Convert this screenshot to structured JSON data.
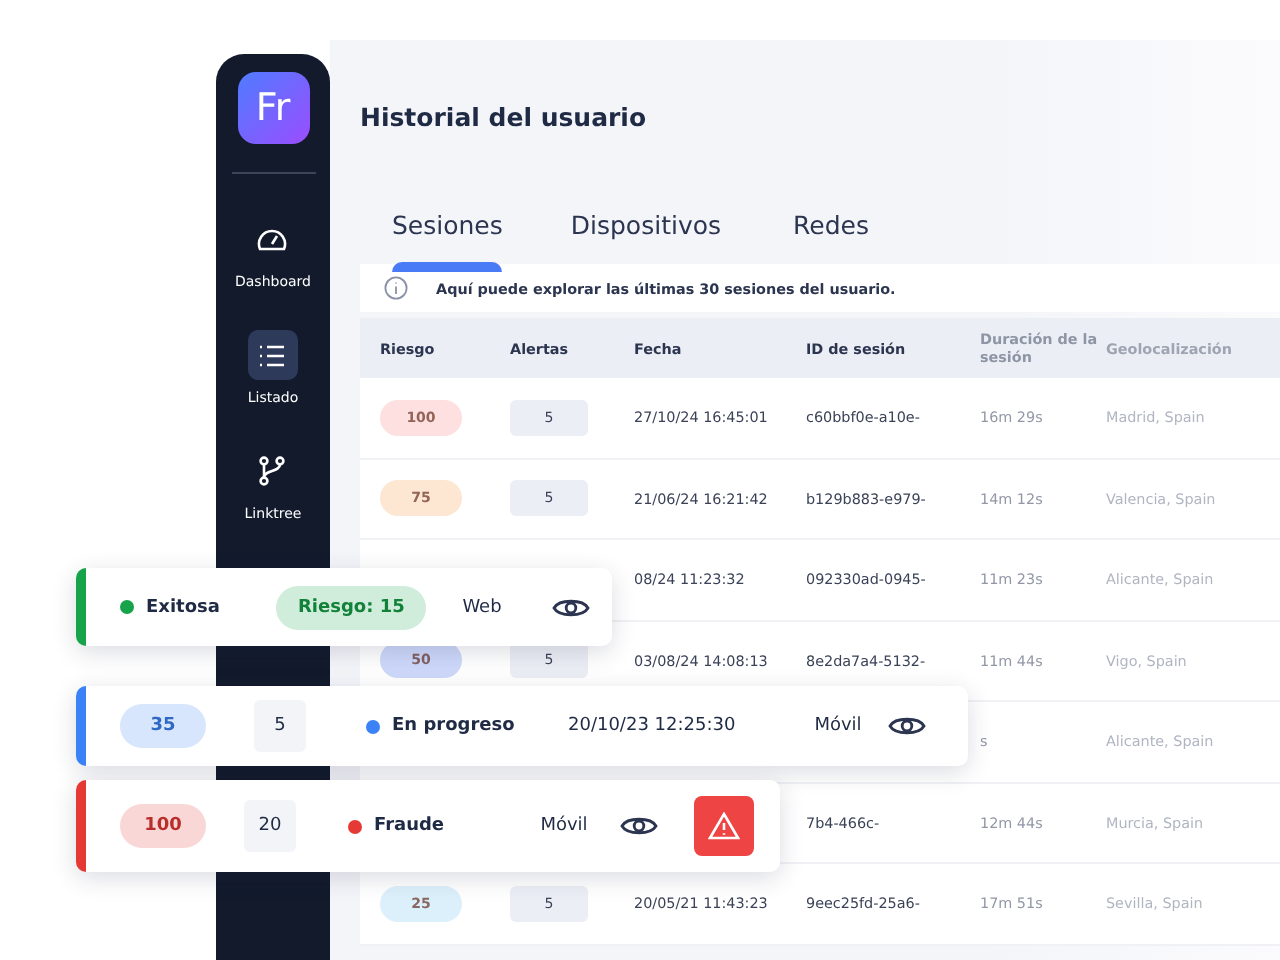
{
  "sidebar": {
    "logo": "Fr",
    "items": [
      {
        "label": "Dashboard",
        "selected": false
      },
      {
        "label": "Listado",
        "selected": true
      },
      {
        "label": "Linktree",
        "selected": false
      }
    ]
  },
  "title": "Historial del usuario",
  "tabs": [
    {
      "label": "Sesiones",
      "selected": true
    },
    {
      "label": "Dispositivos",
      "selected": false
    },
    {
      "label": "Redes",
      "selected": false
    }
  ],
  "info": "Aquí puede explorar las últimas 30 sesiones del usuario.",
  "table": {
    "columns": [
      "Riesgo",
      "Alertas",
      "Fecha",
      "ID de sesión",
      "Duración de la sesión",
      "Geolocalización"
    ],
    "rows": [
      {
        "risk": "100",
        "color": "#fde0df",
        "alerts": "5",
        "date": "27/10/24 16:45:01",
        "id": "c60bbf0e-a10e-",
        "duration": "16m 29s",
        "geo": "Madrid, Spain"
      },
      {
        "risk": "75",
        "color": "#fde6d2",
        "alerts": "5",
        "date": "21/06/24 16:21:42",
        "id": "b129b883-e979-",
        "duration": "14m 12s",
        "geo": "Valencia, Spain"
      },
      {
        "date": "08/24 11:23:32",
        "id": "092330ad-0945-",
        "duration": "11m 23s",
        "geo": "Alicante, Spain"
      },
      {
        "risk": "50",
        "color": "#cdd8fa",
        "alerts": "5",
        "date": "03/08/24 14:08:13",
        "id": "8e2da7a4-5132-",
        "duration": "11m 44s",
        "geo": "Vigo, Spain"
      },
      {
        "duration": "s",
        "geo": "Alicante, Spain"
      },
      {
        "id": "7b4-466c-",
        "duration": "12m 44s",
        "geo": "Murcia, Spain"
      },
      {
        "risk": "25",
        "color": "#dcf0fb",
        "alerts": "5",
        "date": "20/05/21 11:43:23",
        "id": "9eec25fd-25a6-",
        "duration": "17m 51s",
        "geo": "Sevilla, Spain"
      }
    ]
  },
  "session_cards": [
    {
      "kind": "summary",
      "status": "Exitosa",
      "color": "#16a34a",
      "risk": "Riesgo: 15",
      "device": "Web",
      "alert_button": false
    },
    {
      "kind": "detail",
      "risk": "35",
      "alerts": "5",
      "status": "En progreso",
      "color": "#3b82f6",
      "date": "20/10/23 12:25:30",
      "device": "Móvil",
      "alert_button": false
    },
    {
      "kind": "detail",
      "risk": "100",
      "alerts": "20",
      "status": "Fraude",
      "color": "#e53935",
      "device": "Móvil",
      "alert_button": true
    }
  ]
}
